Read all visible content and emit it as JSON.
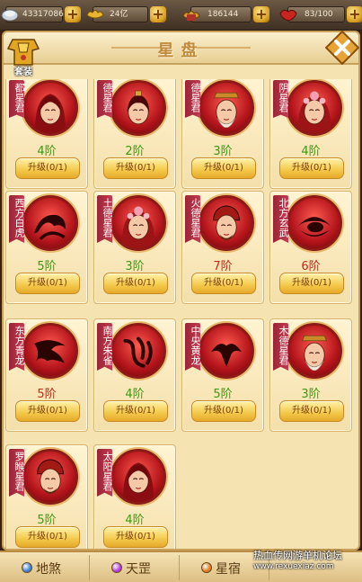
{
  "resources": [
    {
      "icon": "silver-coin-icon",
      "value": "43317086"
    },
    {
      "icon": "gold-ingot-icon",
      "value": "24亿"
    },
    {
      "icon": "bound-ingot-icon",
      "value": "186144"
    },
    {
      "icon": "stamina-icon",
      "value": "83/100"
    }
  ],
  "header": {
    "title": "星盘",
    "set_label": "套装"
  },
  "cards": [
    {
      "name": "都星君",
      "rank": "4阶",
      "rank_color": "green",
      "button": "升级(0/1)",
      "style": "woman"
    },
    {
      "name": "德星君",
      "rank": "2阶",
      "rank_color": "green",
      "button": "升级(0/1)",
      "style": "boy"
    },
    {
      "name": "德星君",
      "rank": "3阶",
      "rank_color": "green",
      "button": "升级(0/1)",
      "style": "elder"
    },
    {
      "name": "阴星君",
      "rank": "4阶",
      "rank_color": "green",
      "button": "升级(0/1)",
      "style": "girl"
    },
    {
      "name": "西方白虎",
      "rank": "5阶",
      "rank_color": "green",
      "button": "升级(0/1)",
      "style": "tiger"
    },
    {
      "name": "土德星君",
      "rank": "3阶",
      "rank_color": "green",
      "button": "升级(0/1)",
      "style": "girl"
    },
    {
      "name": "火德星君",
      "rank": "7阶",
      "rank_color": "red",
      "button": "升级(0/1)",
      "style": "warrior"
    },
    {
      "name": "北方玄武",
      "rank": "6阶",
      "rank_color": "red",
      "button": "升级(0/1)",
      "style": "turtle"
    },
    {
      "name": "东方青龙",
      "rank": "5阶",
      "rank_color": "red",
      "button": "升级(0/1)",
      "style": "dragon"
    },
    {
      "name": "南方朱雀",
      "rank": "4阶",
      "rank_color": "green",
      "button": "升级(0/1)",
      "style": "bird"
    },
    {
      "name": "中央黄龙",
      "rank": "5阶",
      "rank_color": "green",
      "button": "升级(0/1)",
      "style": "yellowdragon"
    },
    {
      "name": "木德星君",
      "rank": "3阶",
      "rank_color": "green",
      "button": "升级(0/1)",
      "style": "elder"
    },
    {
      "name": "罗睺星君",
      "rank": "5阶",
      "rank_color": "green",
      "button": "升级(0/1)",
      "style": "warrior"
    },
    {
      "name": "太阳星君",
      "rank": "4阶",
      "rank_color": "green",
      "button": "升级(0/1)",
      "style": "woman"
    }
  ],
  "tabs": [
    {
      "label": "地煞",
      "dot_color": "#3a7fd6"
    },
    {
      "label": "天罡",
      "dot_color": "#b13ad6"
    },
    {
      "label": "星宿",
      "dot_color": "#e07a1a"
    }
  ],
  "watermark": {
    "line1": "热血传网游单机论坛",
    "line2": "www.rexuexiaz.com"
  }
}
